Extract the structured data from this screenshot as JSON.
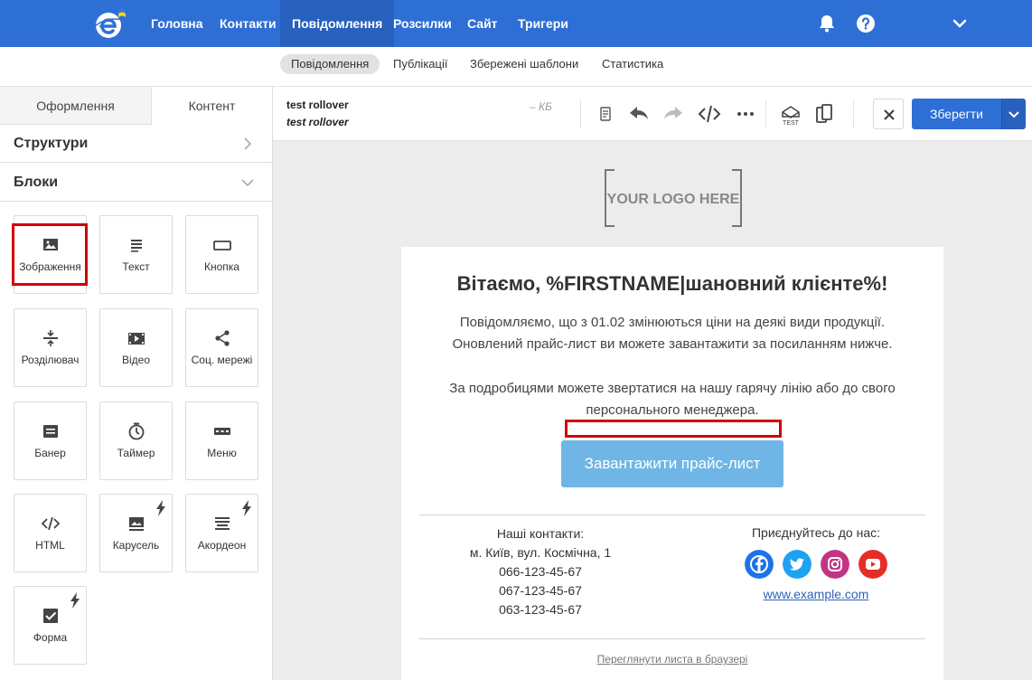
{
  "nav": {
    "items": [
      {
        "label": "Головна"
      },
      {
        "label": "Контакти"
      },
      {
        "label": "Повідомлення",
        "active": true
      },
      {
        "label": "Розсилки"
      },
      {
        "label": "Сайт"
      },
      {
        "label": "Тригери"
      }
    ],
    "icons": [
      "bell-icon",
      "help-icon",
      "chevron-down-icon"
    ],
    "brand_color": "#2e6fd6"
  },
  "subnav": {
    "items": [
      {
        "label": "Повідомлення",
        "active": true
      },
      {
        "label": "Публікації"
      },
      {
        "label": "Збережені шаблони"
      },
      {
        "label": "Статистика"
      }
    ]
  },
  "left_panel": {
    "tabs": [
      {
        "label": "Оформлення"
      },
      {
        "label": "Контент",
        "active": true
      }
    ],
    "sections": [
      {
        "label": "Структури"
      },
      {
        "label": "Блоки"
      }
    ],
    "blocks": [
      {
        "label": "Зображення",
        "icon": "image-icon",
        "highlighted": true
      },
      {
        "label": "Текст",
        "icon": "text-icon"
      },
      {
        "label": "Кнопка",
        "icon": "button-icon"
      },
      {
        "label": "Розділювач",
        "icon": "divider-icon"
      },
      {
        "label": "Відео",
        "icon": "video-icon"
      },
      {
        "label": "Соц. мережі",
        "icon": "share-icon"
      },
      {
        "label": "Банер",
        "icon": "banner-icon"
      },
      {
        "label": "Таймер",
        "icon": "timer-icon"
      },
      {
        "label": "Меню",
        "icon": "menu-icon"
      },
      {
        "label": "HTML",
        "icon": "code-icon"
      },
      {
        "label": "Карусель",
        "icon": "carousel-icon",
        "premium": true
      },
      {
        "label": "Акордеон",
        "icon": "accordion-icon",
        "premium": true
      },
      {
        "label": "Форма",
        "icon": "form-icon",
        "premium": true
      }
    ]
  },
  "toolbar": {
    "title": "test rollover",
    "subtitle": "test rollover",
    "size": "– КБ",
    "icons": [
      "preheader-icon",
      "undo-icon",
      "redo-icon",
      "code-icon",
      "more-icon",
      "test-icon",
      "copy-icon"
    ],
    "save_label": "Зберегти"
  },
  "email": {
    "logo_text": "YOUR LOGO HERE",
    "heading": "Вітаємо, %FIRSTNAME|шановний клієнте%!",
    "p1_line1": "Повідомляємо, що з 01.02 змінюються ціни на деякі види продукції.",
    "p1_line2": "Оновлений прайс-лист ви можете завантажити за посиланням нижче.",
    "p2_line1": "За подробицями можете звертатися на нашу гарячу лінію або до свого",
    "p2_line2": "персонального менеджера.",
    "cta_label": "Завантажити прайс-лист",
    "cta_color": "#6fb6e6",
    "contacts_title": "Наші контакти:",
    "address": "м. Київ, вул. Космічна, 1",
    "phones": [
      "066-123-45-67",
      "067-123-45-67",
      "063-123-45-67"
    ],
    "join_title": "Приєднуйтесь до нас:",
    "socials": [
      {
        "icon": "facebook-icon",
        "color": "#1d72e8"
      },
      {
        "icon": "twitter-icon",
        "color": "#1da1f2"
      },
      {
        "icon": "instagram-icon",
        "color": "#c13584"
      },
      {
        "icon": "youtube-icon",
        "color": "#e52d27"
      }
    ],
    "site_link": "www.example.com",
    "browser_link": "Переглянути листа в браузері"
  }
}
